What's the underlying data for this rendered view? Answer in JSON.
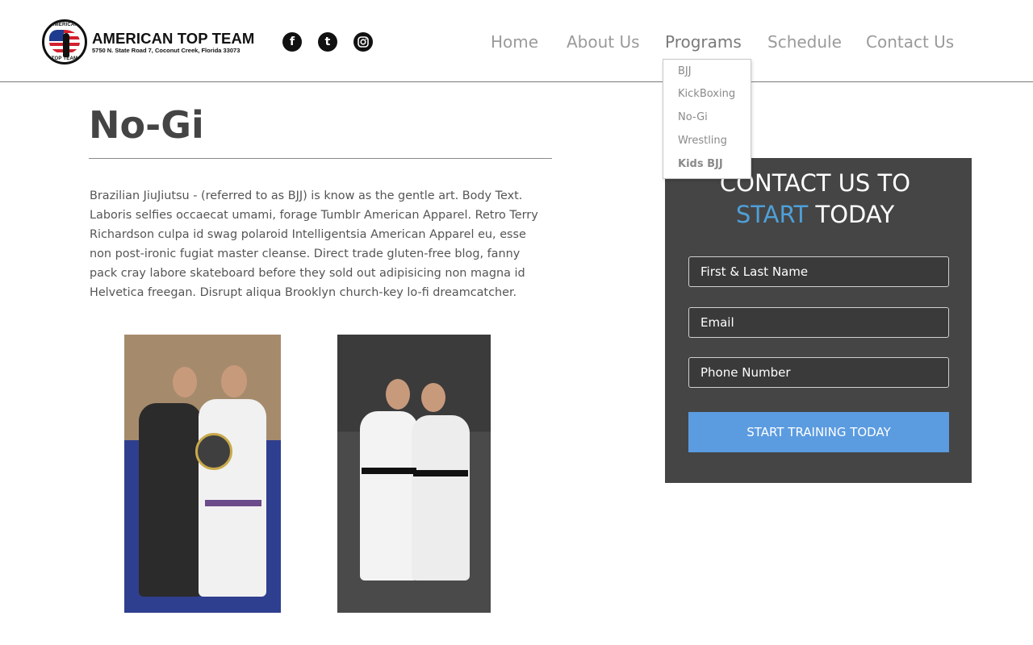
{
  "header": {
    "logo": {
      "title": "AMERICAN TOP TEAM",
      "address": "5750 N. State Road 7, Coconut Creek, Florida 33073",
      "badge_top": "AMERICAN",
      "badge_bottom": "TOP TEAM"
    },
    "social": [
      {
        "name": "facebook",
        "icon": "facebook-icon",
        "glyph": "f"
      },
      {
        "name": "twitter",
        "icon": "twitter-icon",
        "glyph": "t"
      },
      {
        "name": "instagram",
        "icon": "instagram-icon",
        "glyph": ""
      }
    ],
    "nav": [
      {
        "label": "Home"
      },
      {
        "label": "About Us"
      },
      {
        "label": "Programs",
        "active": true
      },
      {
        "label": "Schedule"
      },
      {
        "label": "Contact Us"
      }
    ],
    "programs_dropdown": [
      "BJJ",
      "KickBoxing",
      "No-Gi",
      "Wrestling",
      "Kids BJJ"
    ]
  },
  "main": {
    "title": "No-Gi",
    "body": "Brazilian JiuJiutsu - (referred to as BJJ) is know as the gentle art. Body Text. Laboris selfies occaecat umami, forage Tumblr American Apparel. Retro Terry Richardson culpa id swag polaroid Intelligentsia American Apparel eu, esse non post-ironic fugiat master cleanse. Direct trade gluten-free blog, fanny pack cray labore skateboard before they sold out adipisicing non magna id Helvetica freegan. Disrupt aliqua Brooklyn church-key lo-fi dreamcatcher."
  },
  "contact_form": {
    "heading_line1": "CONTACT US TO",
    "heading_accent": "START",
    "heading_rest": "TODAY",
    "name_placeholder": "First & Last Name",
    "email_placeholder": "Email",
    "phone_placeholder": "Phone Number",
    "submit_label": "START TRAINING TODAY"
  },
  "colors": {
    "accent_blue": "#4ea0d8",
    "button_blue": "#5b9be0",
    "form_background": "#454545",
    "nav_text": "#9a9a9a"
  }
}
